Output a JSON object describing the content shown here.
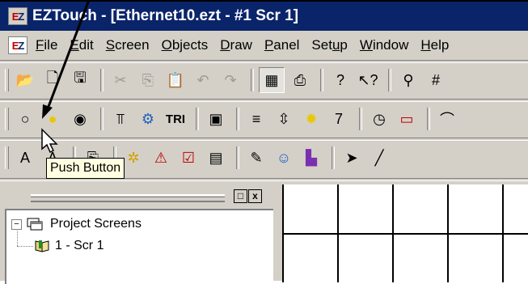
{
  "window": {
    "app_icon": "EZ",
    "title": "EZTouch - [Ethernet10.ezt - #1 Scr 1]"
  },
  "menu": [
    "File",
    "Edit",
    "Screen",
    "Objects",
    "Draw",
    "Panel",
    "Setup",
    "Window",
    "Help"
  ],
  "menu_underline": [
    "F",
    "E",
    "S",
    "O",
    "D",
    "P",
    "u",
    "W",
    "H"
  ],
  "toolbar_standard": [
    {
      "name": "open-icon",
      "glyph": "📂"
    },
    {
      "name": "new-icon",
      "glyph": "🗋"
    },
    {
      "name": "save-icon",
      "glyph": "🖫"
    },
    {
      "name": "cut-icon",
      "glyph": "✂"
    },
    {
      "name": "copy-icon",
      "glyph": "⎘"
    },
    {
      "name": "paste-icon",
      "glyph": "📋"
    },
    {
      "name": "undo-icon",
      "glyph": "↶"
    },
    {
      "name": "redo-icon",
      "glyph": "↷"
    },
    {
      "name": "screen-properties-icon",
      "glyph": "▦"
    },
    {
      "name": "print-icon",
      "glyph": "⎙"
    },
    {
      "name": "help-icon",
      "glyph": "?"
    },
    {
      "name": "context-help-icon",
      "glyph": "↖?"
    },
    {
      "name": "zoom-icon",
      "glyph": "⚲"
    },
    {
      "name": "grid-icon",
      "glyph": "#"
    }
  ],
  "toolbar_objects_1": [
    {
      "name": "push-button-icon",
      "glyph": "○"
    },
    {
      "name": "indicator-button-icon",
      "glyph": "●"
    },
    {
      "name": "selector-switch-icon",
      "glyph": "◉"
    },
    {
      "name": "thumbwheel-icon",
      "glyph": "⫪"
    },
    {
      "name": "lamp-icon",
      "glyph": "⚙"
    },
    {
      "name": "tri-state-icon",
      "glyph": "TRI"
    },
    {
      "name": "numeric-display-icon",
      "glyph": "▣"
    },
    {
      "name": "list-selector-icon",
      "glyph": "≡"
    },
    {
      "name": "numeric-entry-icon",
      "glyph": "⇳"
    },
    {
      "name": "pilot-light-icon",
      "glyph": "✹"
    },
    {
      "name": "digital-display-icon",
      "glyph": "7"
    },
    {
      "name": "clock-icon",
      "glyph": "◷"
    },
    {
      "name": "message-display-icon",
      "glyph": "▭"
    },
    {
      "name": "meter-icon",
      "glyph": "⌒"
    }
  ],
  "toolbar_objects_2": [
    {
      "name": "static-text-icon",
      "glyph": "A"
    },
    {
      "name": "dynamic-text-icon",
      "glyph": "A"
    },
    {
      "name": "text-entry-icon",
      "glyph": "⎘"
    },
    {
      "name": "bitmap-icon",
      "glyph": "✲"
    },
    {
      "name": "alarm-icon",
      "glyph": "⚠"
    },
    {
      "name": "checklist-icon",
      "glyph": "☑"
    },
    {
      "name": "text-display-icon",
      "glyph": "▤"
    },
    {
      "name": "edit-object-icon",
      "glyph": "✎"
    },
    {
      "name": "face-icon",
      "glyph": "☺"
    },
    {
      "name": "color-bars-icon",
      "glyph": "▙"
    },
    {
      "name": "select-arrow-icon",
      "glyph": "➤"
    },
    {
      "name": "line-icon",
      "glyph": "╱"
    }
  ],
  "tooltip": "Push Button",
  "project_panel": {
    "restore_glyph": "□",
    "close_glyph": "x",
    "root": "Project Screens",
    "child": "1 - Scr 1"
  },
  "colors": {
    "titlebar": "#0a246a",
    "face": "#d4d0c8",
    "tooltip_bg": "#ffffe1",
    "grid": "#000000"
  }
}
